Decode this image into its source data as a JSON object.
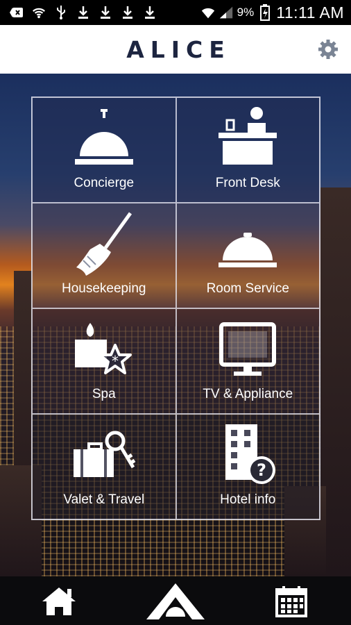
{
  "status_bar": {
    "battery_percent": "9%",
    "time": "11:11 AM",
    "icons": [
      "back-arrow-icon",
      "wifi-icon",
      "usb-icon",
      "download-icon",
      "download-icon",
      "download-icon",
      "download-icon",
      "wifi-signal-icon",
      "cell-signal-icon",
      "battery-icon"
    ]
  },
  "header": {
    "title": "ALICE",
    "settings_icon": "gear-icon"
  },
  "tiles": [
    {
      "label": "Concierge",
      "icon": "concierge-bell-icon"
    },
    {
      "label": "Front Desk",
      "icon": "front-desk-icon"
    },
    {
      "label": "Housekeeping",
      "icon": "broom-icon"
    },
    {
      "label": "Room Service",
      "icon": "food-cloche-icon"
    },
    {
      "label": "Spa",
      "icon": "spa-candle-icon"
    },
    {
      "label": "TV & Appliance",
      "icon": "tv-icon"
    },
    {
      "label": "Valet & Travel",
      "icon": "luggage-key-icon"
    },
    {
      "label": "Hotel info",
      "icon": "hotel-building-info-icon"
    }
  ],
  "bottom_nav": {
    "home_icon": "home-icon",
    "main_icon": "alice-logo-icon",
    "calendar_icon": "calendar-icon"
  },
  "colors": {
    "header_bg": "#ffffff",
    "title_color": "#1d2540",
    "tile_text": "#ffffff",
    "nav_bg": "#0b0b0d"
  }
}
